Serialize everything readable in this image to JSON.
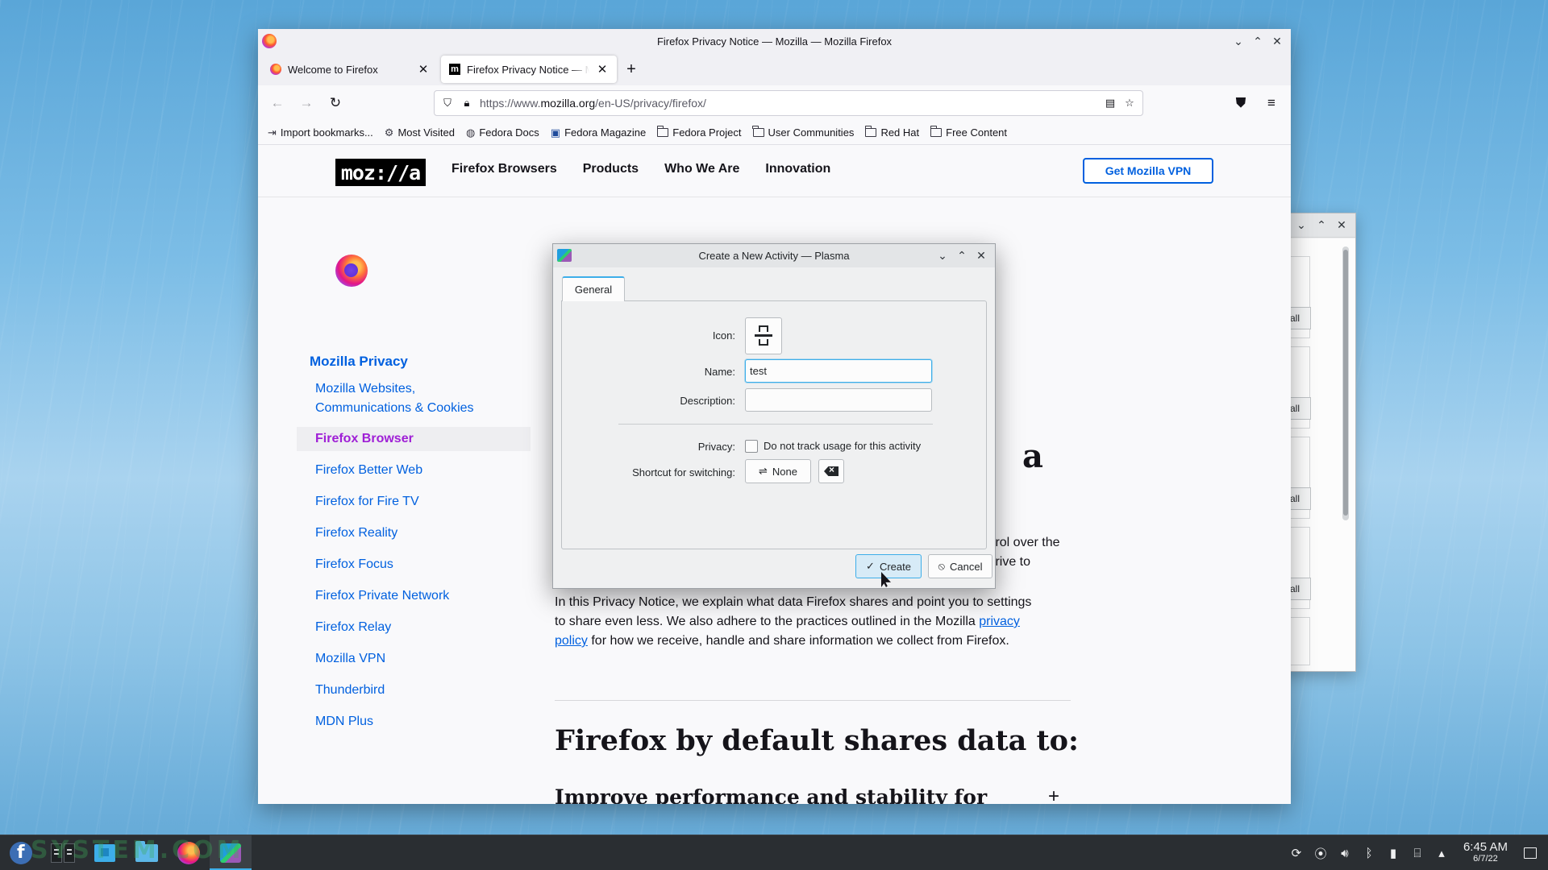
{
  "firefox": {
    "window_title": "Firefox Privacy Notice — Mozilla — Mozilla Firefox",
    "tabs": [
      {
        "title": "Welcome to Firefox",
        "active": false
      },
      {
        "title": "Firefox Privacy Notice — Mozilla",
        "active": true
      }
    ],
    "url_prefix": "https://www.",
    "url_domain": "mozilla.org",
    "url_path": "/en-US/privacy/firefox/",
    "bookmarks": [
      {
        "label": "Import bookmarks...",
        "icon": "import-icon"
      },
      {
        "label": "Most Visited",
        "icon": "gear-icon"
      },
      {
        "label": "Fedora Docs",
        "icon": "globe-icon"
      },
      {
        "label": "Fedora Magazine",
        "icon": "bookmark-icon"
      },
      {
        "label": "Fedora Project",
        "icon": "folder-icon"
      },
      {
        "label": "User Communities",
        "icon": "folder-icon"
      },
      {
        "label": "Red Hat",
        "icon": "folder-icon"
      },
      {
        "label": "Free Content",
        "icon": "folder-icon"
      }
    ]
  },
  "site": {
    "logo": "moz://a",
    "nav": [
      "Firefox Browsers",
      "Products",
      "Who We Are",
      "Innovation"
    ],
    "cta": "Get Mozilla VPN",
    "side_title": "Mozilla Privacy",
    "side_items": [
      "Mozilla Websites, Communications & Cookies",
      "Firefox Browser",
      "Firefox Better Web",
      "Firefox for Fire TV",
      "Firefox Reality",
      "Firefox Focus",
      "Firefox Private Network",
      "Firefox Relay",
      "Mozilla VPN",
      "Thunderbird",
      "MDN Plus"
    ],
    "side_active": "Firefox Browser",
    "frag_comma": ",",
    "frag_a": "a",
    "frag_line1": "trol over the",
    "frag_line2": "trive to",
    "para_line1": "In this Privacy Notice, we explain what data Firefox shares and point you to settings",
    "para_line2_pre": "to share even less. We also adhere to the practices outlined in the Mozilla ",
    "para_link1": "privacy",
    "para_link2": "policy",
    "para_line3_post": " for how we receive, handle and share information we collect from Firefox.",
    "h2": "Firefox by default shares data to:",
    "h3": "Improve performance and stability for users everywhere"
  },
  "bg_window": {
    "button_label": "all"
  },
  "dialog": {
    "title": "Create a New Activity — Plasma",
    "tab": "General",
    "icon_label": "Icon:",
    "name_label": "Name:",
    "name_value": "test",
    "description_label": "Description:",
    "description_value": "",
    "privacy_label": "Privacy:",
    "privacy_checkbox": "Do not track usage for this activity",
    "privacy_checked": false,
    "shortcut_label": "Shortcut for switching:",
    "shortcut_value": "None",
    "create_label": "Create",
    "cancel_label": "Cancel"
  },
  "taskbar": {
    "time": "6:45 AM",
    "date": "6/7/22",
    "watermark": "SYSTEM.COM"
  },
  "colors": {
    "accent": "#3daee9",
    "link": "#0060df",
    "active_side": "#9f1fd6"
  }
}
